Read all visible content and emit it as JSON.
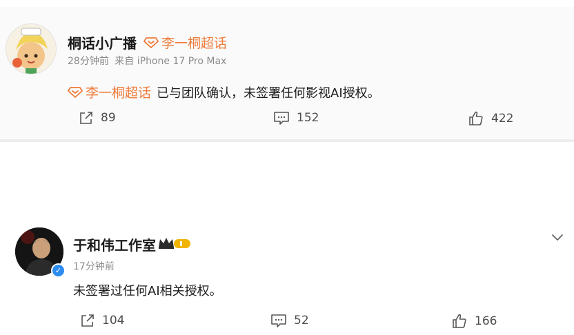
{
  "post1": {
    "author": "桐话小广播",
    "super_topic": "李一桐超话",
    "time": "28分钟前",
    "source": "来自 iPhone 17 Pro Max",
    "content_topic": "李一桐超话",
    "content_text": "已与团队确认，未签署任何影视AI授权。",
    "shares": "89",
    "comments": "152",
    "likes": "422"
  },
  "post2": {
    "author": "于和伟工作室",
    "time": "17分钟前",
    "content_text": "未签署过任何AI相关授权。",
    "shares": "104",
    "comments": "52",
    "likes": "166"
  },
  "colors": {
    "accent_orange": "#ee7b3a",
    "meta_gray": "#8b8b8b",
    "verified_blue": "#2d8cf0",
    "crown_gold": "#f0b400"
  },
  "icons": [
    "super-topic-icon",
    "share-icon",
    "comment-icon",
    "like-icon",
    "verified-icon",
    "crown-badge-icon",
    "chevron-down-icon"
  ]
}
